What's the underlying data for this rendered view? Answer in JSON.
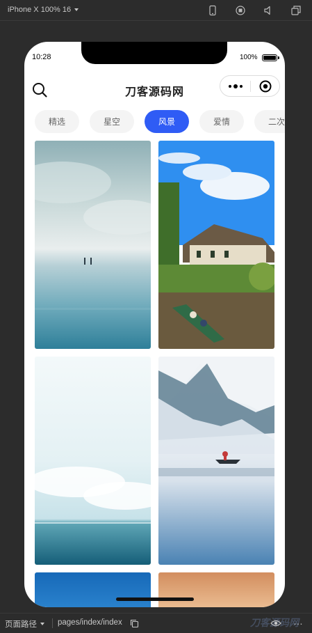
{
  "devtools": {
    "device_label": "iPhone X 100% 16",
    "path_label": "页面路径",
    "path_value": "pages/index/index",
    "watermark": "刀客源码网"
  },
  "status_bar": {
    "time": "10:28",
    "battery_text": "100%"
  },
  "navbar": {
    "title": "刀客源码网"
  },
  "tabs": [
    {
      "label": "精选",
      "active": false
    },
    {
      "label": "星空",
      "active": false
    },
    {
      "label": "风景",
      "active": true
    },
    {
      "label": "爱情",
      "active": false
    },
    {
      "label": "二次",
      "active": false
    }
  ],
  "wallpapers": [
    {
      "scene": "cloudy-beach-people",
      "colors": [
        "#9fb8bd",
        "#d7e3e3",
        "#3d8ea6"
      ]
    },
    {
      "scene": "thatched-village-canal-boat",
      "colors": [
        "#2f8ff0",
        "#e9f3fb",
        "#4d7a2e"
      ]
    },
    {
      "scene": "bright-sky-ocean",
      "colors": [
        "#eaf5f7",
        "#b9dde4",
        "#1f6d85"
      ]
    },
    {
      "scene": "misty-lake-boat-mountains",
      "colors": [
        "#6d8fa8",
        "#e9eef4",
        "#4c83b5"
      ]
    },
    {
      "scene": "blue-sky",
      "colors": [
        "#1769b8",
        "#2d86d0"
      ]
    },
    {
      "scene": "warm-sunset",
      "colors": [
        "#d28e5f",
        "#efc49a"
      ]
    }
  ],
  "accent_color": "#2f5cf5"
}
